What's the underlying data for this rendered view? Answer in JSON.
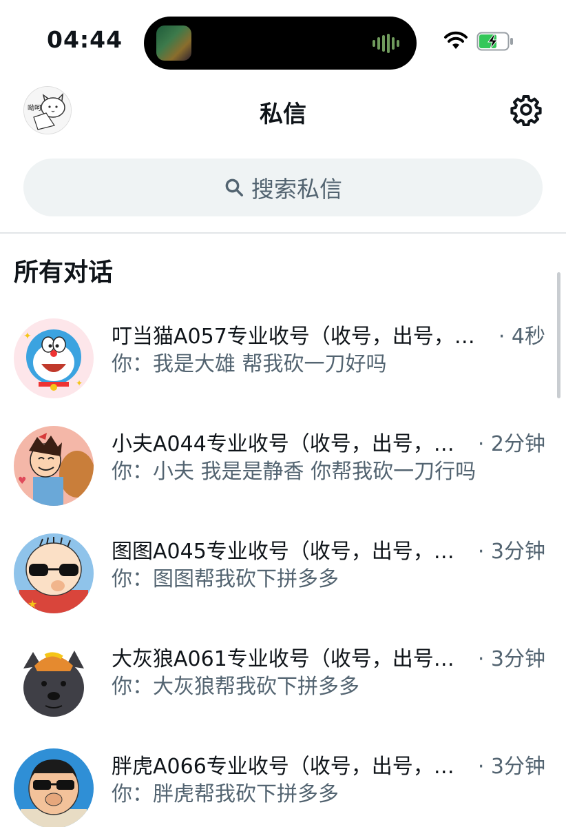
{
  "status_bar": {
    "time": "04:44"
  },
  "header": {
    "title": "私信",
    "avatar_text": "呦呵"
  },
  "search": {
    "placeholder": "搜索私信"
  },
  "section": {
    "title": "所有对话"
  },
  "conversations": [
    {
      "name": "叮当猫A057专业收号（收号，出号，…",
      "time": "· 4秒",
      "preview": "你：我是大雄 帮我砍一刀好吗"
    },
    {
      "name": "小夫A044专业收号（收号，出号，…",
      "time": "· 2分钟",
      "preview": "你：小夫 我是是静香 你帮我砍一刀行吗"
    },
    {
      "name": "图图A045专业收号（收号，出号，…",
      "time": "· 3分钟",
      "preview": "你：图图帮我砍下拼多多"
    },
    {
      "name": "大灰狼A061专业收号（收号，出号…",
      "time": "· 3分钟",
      "preview": "你：大灰狼帮我砍下拼多多"
    },
    {
      "name": "胖虎A066专业收号（收号，出号，…",
      "time": "· 3分钟",
      "preview": "你：胖虎帮我砍下拼多多"
    }
  ],
  "colors": {
    "text": "#0f1419",
    "secondary": "#536471",
    "search_bg": "#eff3f4",
    "battery_charge": "#34c759"
  }
}
